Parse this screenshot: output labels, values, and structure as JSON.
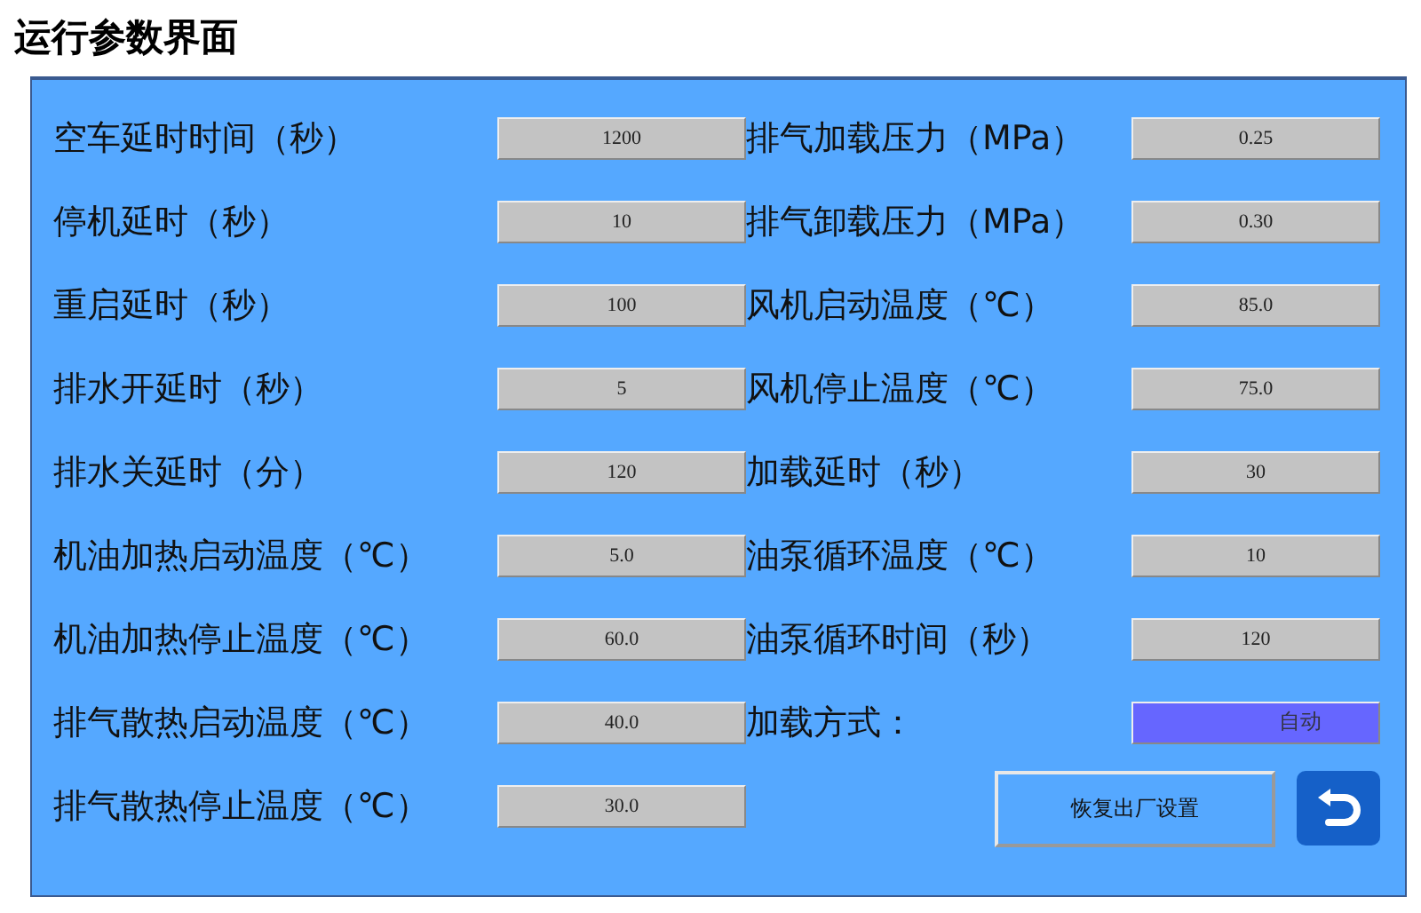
{
  "title": "运行参数界面",
  "left_params": [
    {
      "label": "空车延时时间（秒）",
      "value": "1200"
    },
    {
      "label": "停机延时（秒）",
      "value": "10"
    },
    {
      "label": "重启延时（秒）",
      "value": "100"
    },
    {
      "label": "排水开延时（秒）",
      "value": "5"
    },
    {
      "label": "排水关延时（分）",
      "value": "120"
    },
    {
      "label": "机油加热启动温度（℃）",
      "value": "5.0"
    },
    {
      "label": "机油加热停止温度（℃）",
      "value": "60.0"
    },
    {
      "label": "排气散热启动温度（℃）",
      "value": "40.0"
    },
    {
      "label": "排气散热停止温度（℃）",
      "value": "30.0"
    }
  ],
  "right_params": [
    {
      "label": "排气加载压力（MPa）",
      "value": "0.25"
    },
    {
      "label": "排气卸载压力（MPa）",
      "value": "0.30"
    },
    {
      "label": "风机启动温度（℃）",
      "value": "85.0"
    },
    {
      "label": "风机停止温度（℃）",
      "value": "75.0"
    },
    {
      "label": "加载延时（秒）",
      "value": "30"
    },
    {
      "label": "油泵循环温度（℃）",
      "value": "10"
    },
    {
      "label": "油泵循环时间（秒）",
      "value": "120"
    }
  ],
  "load_mode": {
    "label": "加载方式：",
    "value": "自动"
  },
  "reset_button": "恢复出厂设置"
}
